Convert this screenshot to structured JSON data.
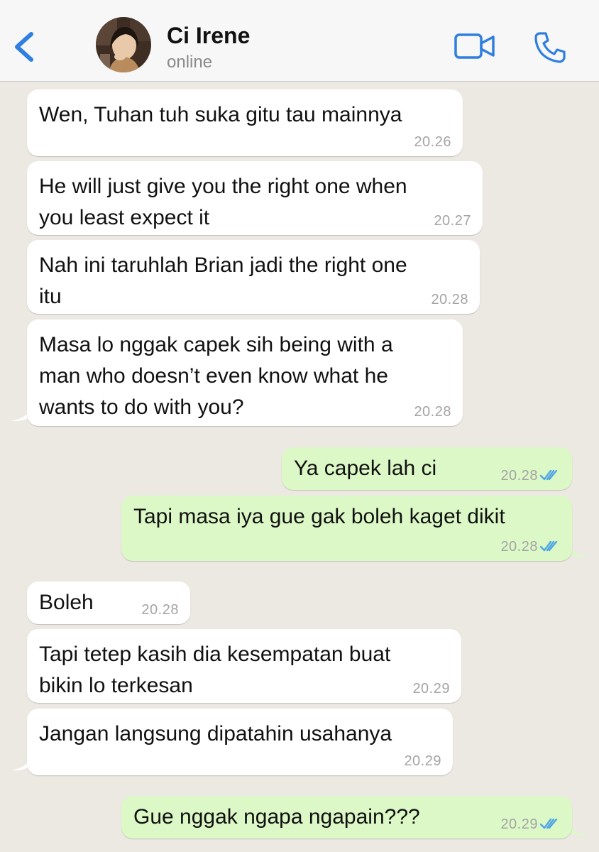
{
  "header": {
    "contact_name": "Ci Irene",
    "status": "online"
  },
  "colors": {
    "accent": "#2F7FE0",
    "incoming_bubble": "#FFFFFF",
    "outgoing_bubble": "#DCF8C6",
    "chat_background": "#ECE9E3",
    "read_ticks": "#4FA6E6"
  },
  "icons": {
    "back": "chevron-left-icon",
    "video": "video-camera-icon",
    "call": "phone-icon",
    "read": "double-check-icon"
  },
  "messages": [
    {
      "direction": "in",
      "lines": [
        "Wen, Tuhan tuh suka gitu tau mainnya"
      ],
      "time": "20.26"
    },
    {
      "direction": "in",
      "lines": [
        "He will just give you the right one when",
        "you least expect it"
      ],
      "time": "20.27"
    },
    {
      "direction": "in",
      "lines": [
        "Nah ini taruhlah Brian jadi the right one",
        "itu"
      ],
      "time": "20.28"
    },
    {
      "direction": "in",
      "lines": [
        "Masa lo nggak capek sih being with a",
        "man who doesn’t even know what he",
        "wants to do with you?"
      ],
      "time": "20.28"
    },
    {
      "direction": "out",
      "lines": [
        "Ya capek lah ci"
      ],
      "time": "20.28"
    },
    {
      "direction": "out",
      "lines": [
        "Tapi masa iya gue gak boleh kaget dikit"
      ],
      "time": "20.28"
    },
    {
      "direction": "in",
      "lines": [
        "Boleh"
      ],
      "time": "20.28"
    },
    {
      "direction": "in",
      "lines": [
        "Tapi tetep kasih dia kesempatan buat",
        "bikin lo terkesan"
      ],
      "time": "20.29"
    },
    {
      "direction": "in",
      "lines": [
        "Jangan langsung dipatahin usahanya"
      ],
      "time": "20.29"
    },
    {
      "direction": "out",
      "lines": [
        "Gue nggak ngapa ngapain???"
      ],
      "time": "20.29"
    }
  ]
}
